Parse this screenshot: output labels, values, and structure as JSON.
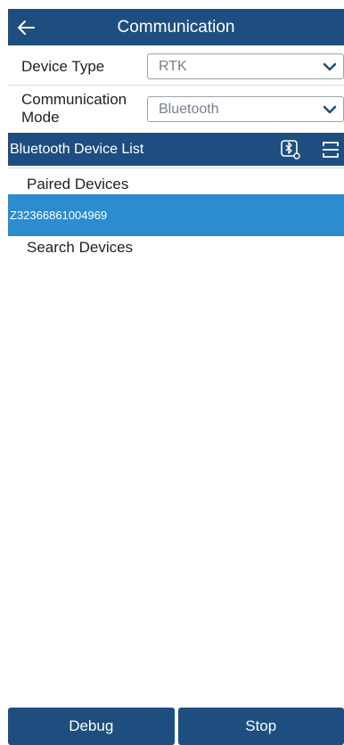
{
  "header": {
    "title": "Communication"
  },
  "settings": {
    "device_type": {
      "label": "Device Type",
      "value": "RTK"
    },
    "communication_mode": {
      "label_line1": "Communication",
      "label_line2": "Mode",
      "value": "Bluetooth"
    }
  },
  "device_list": {
    "title": "Bluetooth Device List",
    "paired_label": "Paired Devices",
    "paired_devices": [
      "Z32366861004969"
    ],
    "search_label": "Search Devices"
  },
  "footer": {
    "debug_label": "Debug",
    "stop_label": "Stop"
  },
  "colors": {
    "primary": "#1e4e7f",
    "selected": "#2b8ccf"
  }
}
